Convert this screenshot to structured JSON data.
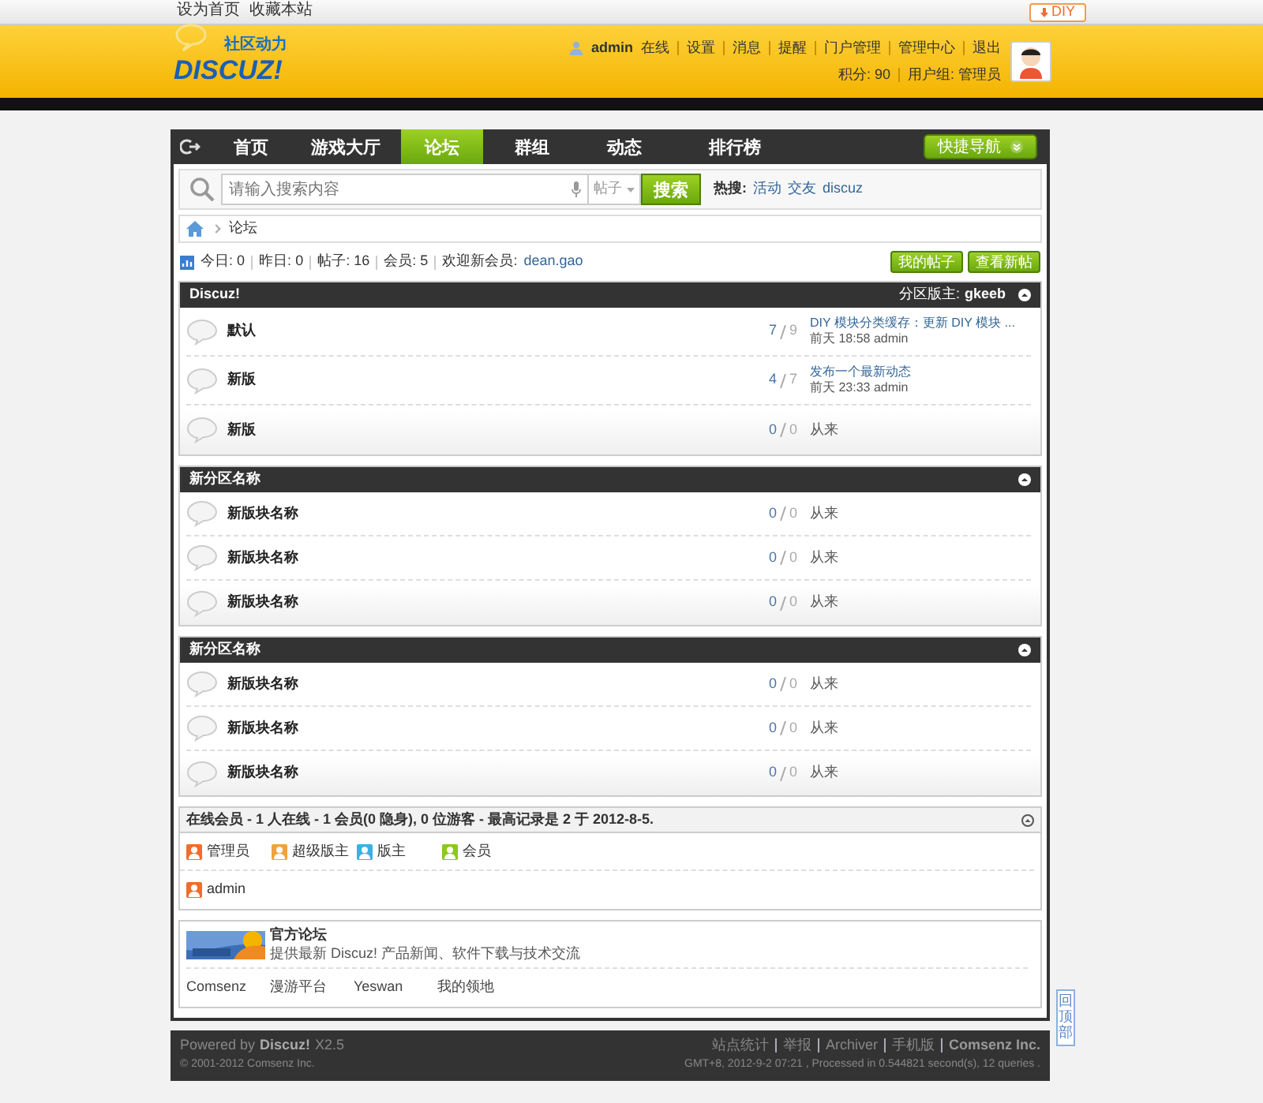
{
  "topbar": {
    "links": [
      "设为首页",
      "收藏本站"
    ],
    "diy": "DIY"
  },
  "logo": {
    "tagline": "社区动力",
    "name": "DISCUZ!"
  },
  "user": {
    "name": "admin",
    "status": "在线",
    "links": [
      "设置",
      "消息",
      "提醒",
      "门户管理",
      "管理中心",
      "退出"
    ],
    "credits": "积分: 90",
    "group": "用户组: 管理员"
  },
  "nav": {
    "items": [
      {
        "label": "首页",
        "selected": false
      },
      {
        "label": "游戏大厅",
        "selected": false
      },
      {
        "label": "论坛",
        "selected": true
      },
      {
        "label": "群组",
        "selected": false
      },
      {
        "label": "动态",
        "selected": false
      },
      {
        "label": "排行榜",
        "selected": false
      }
    ],
    "quick": "快捷导航"
  },
  "search": {
    "placeholder": "请输入搜索内容",
    "type": "帖子",
    "button": "搜索",
    "hot_label": "热搜:",
    "hot": [
      "活动",
      "交友",
      "discuz"
    ]
  },
  "breadcrumb": [
    "论坛"
  ],
  "stats": {
    "items": [
      {
        "label": "今日:",
        "value": "0"
      },
      {
        "label": "昨日:",
        "value": "0"
      },
      {
        "label": "帖子:",
        "value": "16"
      },
      {
        "label": "会员:",
        "value": "5"
      }
    ],
    "welcome": "欢迎新会员:",
    "new_member": "dean.gao",
    "buttons": [
      "我的帖子",
      "查看新帖"
    ]
  },
  "sections": [
    {
      "title": "Discuz!",
      "moderator_label": "分区版主:",
      "moderator": "gkeeb",
      "forums": [
        {
          "name": "默认",
          "topics": "7",
          "posts": "9",
          "last_post": {
            "title": "DIY 模块分类缓存：更新 DIY 模块 ...",
            "time": "前天 18:58 admin"
          }
        },
        {
          "name": "新版",
          "topics": "4",
          "posts": "7",
          "last_post": {
            "title": "发布一个最新动态",
            "time": "前天 23:33 admin"
          }
        },
        {
          "name": "新版",
          "topics": "0",
          "posts": "0",
          "never": "从来"
        }
      ]
    },
    {
      "title": "新分区名称",
      "forums": [
        {
          "name": "新版块名称",
          "topics": "0",
          "posts": "0",
          "never": "从来"
        },
        {
          "name": "新版块名称",
          "topics": "0",
          "posts": "0",
          "never": "从来"
        },
        {
          "name": "新版块名称",
          "topics": "0",
          "posts": "0",
          "never": "从来"
        }
      ]
    },
    {
      "title": "新分区名称",
      "forums": [
        {
          "name": "新版块名称",
          "topics": "0",
          "posts": "0",
          "never": "从来"
        },
        {
          "name": "新版块名称",
          "topics": "0",
          "posts": "0",
          "never": "从来"
        },
        {
          "name": "新版块名称",
          "topics": "0",
          "posts": "0",
          "never": "从来"
        }
      ]
    }
  ],
  "online": {
    "title": "在线会员 - 1 人在线 - 1 会员(0 隐身), 0 位游客 - 最高记录是 2 于 2012-8-5.",
    "legend": [
      {
        "label": "管理员",
        "color": "#f26c2b"
      },
      {
        "label": "超级版主",
        "color": "#f0a23c"
      },
      {
        "label": "版主",
        "color": "#3ab0e2"
      },
      {
        "label": "会员",
        "color": "#8cc820"
      }
    ],
    "users": [
      {
        "name": "admin",
        "color": "#f26c2b"
      }
    ]
  },
  "friend_links": {
    "featured": {
      "title": "官方论坛",
      "desc": "提供最新 Discuz! 产品新闻、软件下载与技术交流"
    },
    "links": [
      "Comsenz",
      "漫游平台",
      "Yeswan",
      "我的领地"
    ]
  },
  "footer": {
    "powered": "Powered by",
    "product": "Discuz!",
    "version": "X2.5",
    "copyright": "© 2001-2012 Comsenz Inc.",
    "links": [
      "站点统计",
      "举报",
      "Archiver",
      "手机版"
    ],
    "company": "Comsenz Inc.",
    "info": "GMT+8, 2012-9-2 07:21 , Processed in 0.544821 second(s), 12 queries ."
  },
  "back_to_top": "回顶部"
}
